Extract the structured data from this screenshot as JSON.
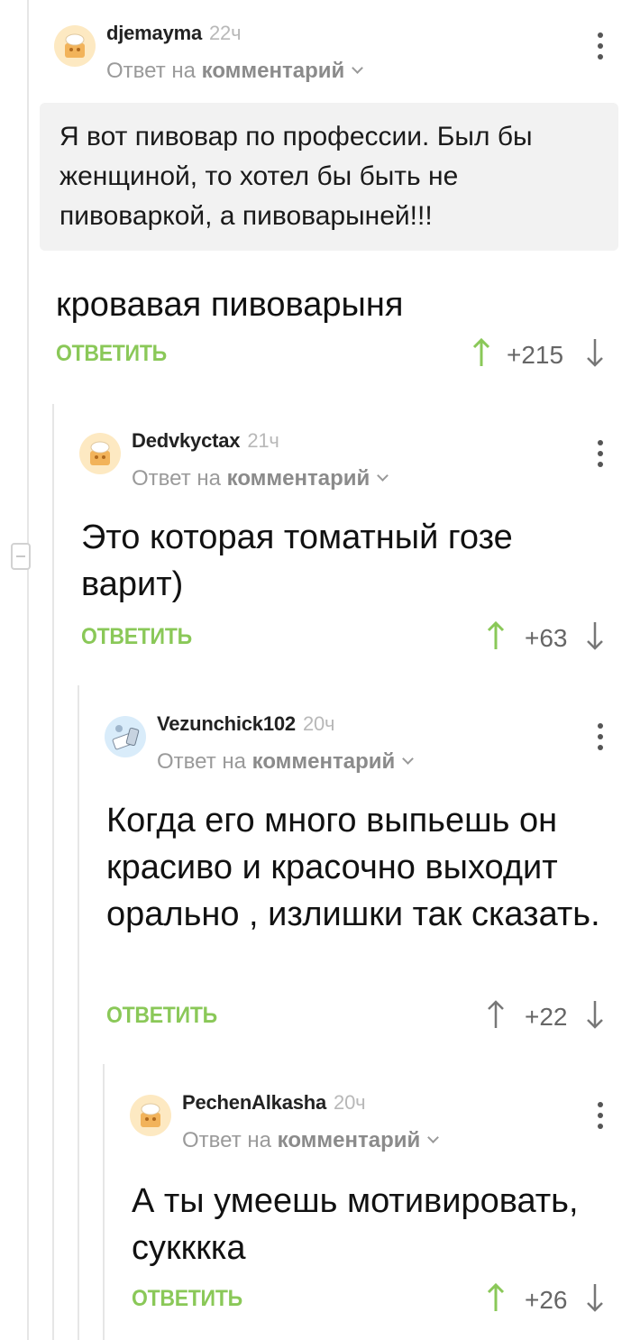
{
  "colors": {
    "accent_green": "#8ac858",
    "quote_bg": "#f2f2f2",
    "muted": "#9a9a9a",
    "thread_line": "#e6e6e6"
  },
  "comments": [
    {
      "author": "djemayma",
      "time": "22ч",
      "reply_prefix": "Ответ на",
      "reply_link": "комментарий",
      "quote": "Я вот пивовар по профессии. Был бы женщиной, то хотел бы быть не пивоваркой, а пивоварыней!!!",
      "text": "кровавая пивоварыня",
      "reply_label": "ОТВЕТИТЬ",
      "rating": "+215",
      "upvoted": true
    },
    {
      "author": "Dedvkyctax",
      "time": "21ч",
      "reply_prefix": "Ответ на",
      "reply_link": "комментарий",
      "text": "Это которая томатный гозе варит)",
      "reply_label": "ОТВЕТИТЬ",
      "rating": "+63",
      "upvoted": true
    },
    {
      "author": "Vezunchick102",
      "time": "20ч",
      "reply_prefix": "Ответ на",
      "reply_link": "комментарий",
      "text": "Когда его много выпьешь он красиво и красочно выходит орально , излишки так сказать.",
      "reply_label": "ОТВЕТИТЬ",
      "rating": "+22",
      "upvoted": false
    },
    {
      "author": "PechenAlkasha",
      "time": "20ч",
      "reply_prefix": "Ответ на",
      "reply_link": "комментарий",
      "text": "А ты умеешь мотивировать, сукккка",
      "reply_label": "ОТВЕТИТЬ",
      "rating": "+26",
      "upvoted": true
    }
  ]
}
